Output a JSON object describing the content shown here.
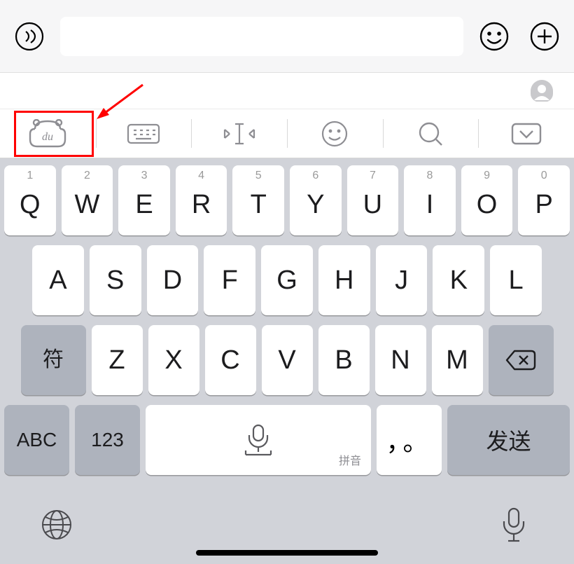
{
  "toolbar": {
    "baidu_icon_text": "du"
  },
  "keyboard": {
    "row1": [
      {
        "num": "1",
        "letter": "Q"
      },
      {
        "num": "2",
        "letter": "W"
      },
      {
        "num": "3",
        "letter": "E"
      },
      {
        "num": "4",
        "letter": "R"
      },
      {
        "num": "5",
        "letter": "T"
      },
      {
        "num": "6",
        "letter": "Y"
      },
      {
        "num": "7",
        "letter": "U"
      },
      {
        "num": "8",
        "letter": "I"
      },
      {
        "num": "9",
        "letter": "O"
      },
      {
        "num": "0",
        "letter": "P"
      }
    ],
    "row2": [
      "A",
      "S",
      "D",
      "F",
      "G",
      "H",
      "J",
      "K",
      "L"
    ],
    "row3": [
      "Z",
      "X",
      "C",
      "V",
      "B",
      "N",
      "M"
    ],
    "symbol_key": "符",
    "abc_key": "ABC",
    "num_key": "123",
    "space_mode": "拼音",
    "punct_key": "，。",
    "send_key": "发送"
  }
}
